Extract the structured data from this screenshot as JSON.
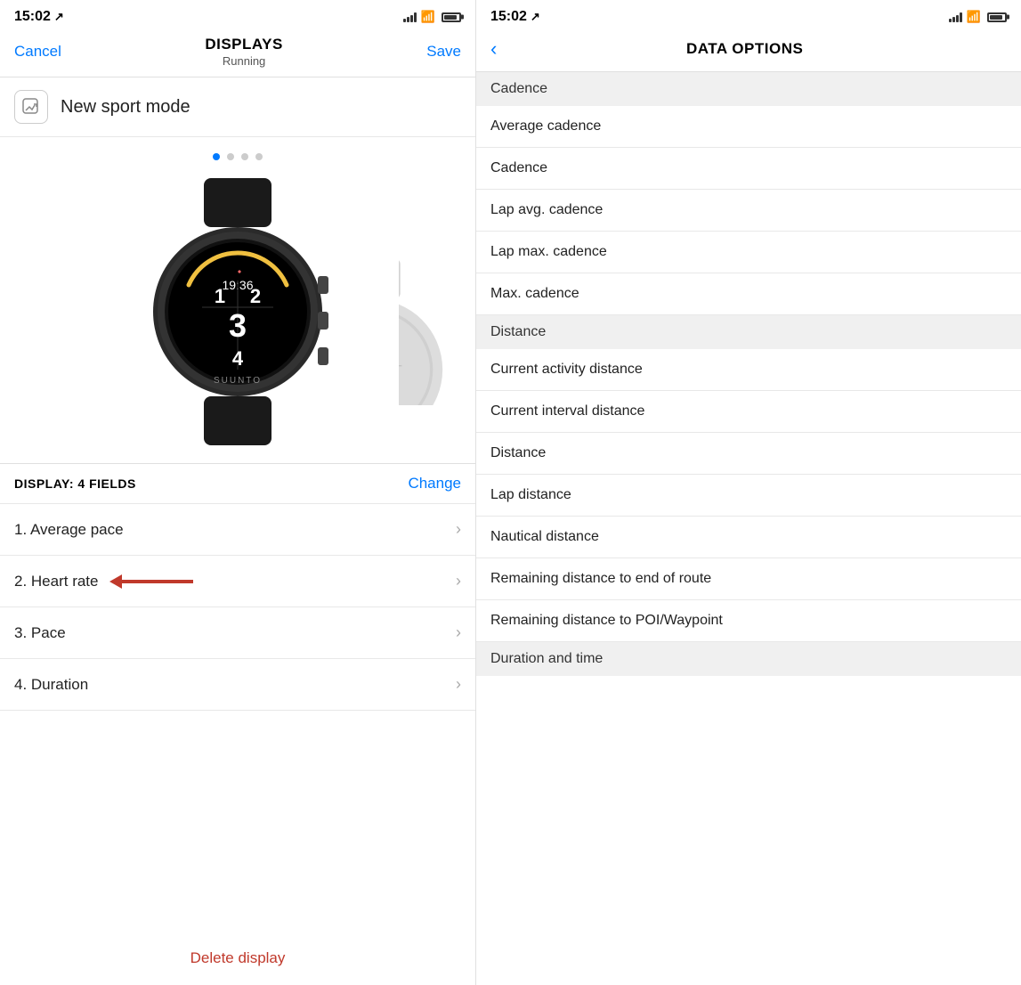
{
  "left": {
    "statusBar": {
      "time": "15:02",
      "locationIcon": "↗"
    },
    "header": {
      "cancelLabel": "Cancel",
      "title": "DISPLAYS",
      "subtitle": "Running",
      "saveLabel": "Save"
    },
    "sportMode": {
      "label": "New sport mode",
      "iconSymbol": "✏"
    },
    "dots": [
      {
        "active": true
      },
      {
        "active": false
      },
      {
        "active": false
      },
      {
        "active": false
      }
    ],
    "displayInfo": {
      "label": "DISPLAY: 4 FIELDS",
      "changeLabel": "Change"
    },
    "fields": [
      {
        "id": 1,
        "text": "1. Average pace",
        "hasArrow": false
      },
      {
        "id": 2,
        "text": "2. Heart rate",
        "hasArrow": true
      },
      {
        "id": 3,
        "text": "3. Pace",
        "hasArrow": false
      },
      {
        "id": 4,
        "text": "4. Duration",
        "hasArrow": false
      }
    ],
    "deleteLabel": "Delete display"
  },
  "right": {
    "statusBar": {
      "time": "15:02",
      "locationIcon": "↗"
    },
    "header": {
      "backLabel": "‹",
      "title": "DATA OPTIONS"
    },
    "sections": [
      {
        "header": "Cadence",
        "isHeader": true,
        "items": []
      },
      {
        "header": null,
        "isHeader": false,
        "items": [
          "Average cadence",
          "Cadence",
          "Lap avg. cadence",
          "Lap max. cadence",
          "Max. cadence"
        ]
      },
      {
        "header": "Distance",
        "isHeader": true,
        "items": []
      },
      {
        "header": null,
        "isHeader": false,
        "items": [
          "Current activity distance",
          "Current interval distance",
          "Distance",
          "Lap distance",
          "Nautical distance",
          "Remaining distance to end of route",
          "Remaining distance to POI/Waypoint"
        ]
      },
      {
        "header": "Duration and time",
        "isHeader": true,
        "items": []
      }
    ]
  }
}
